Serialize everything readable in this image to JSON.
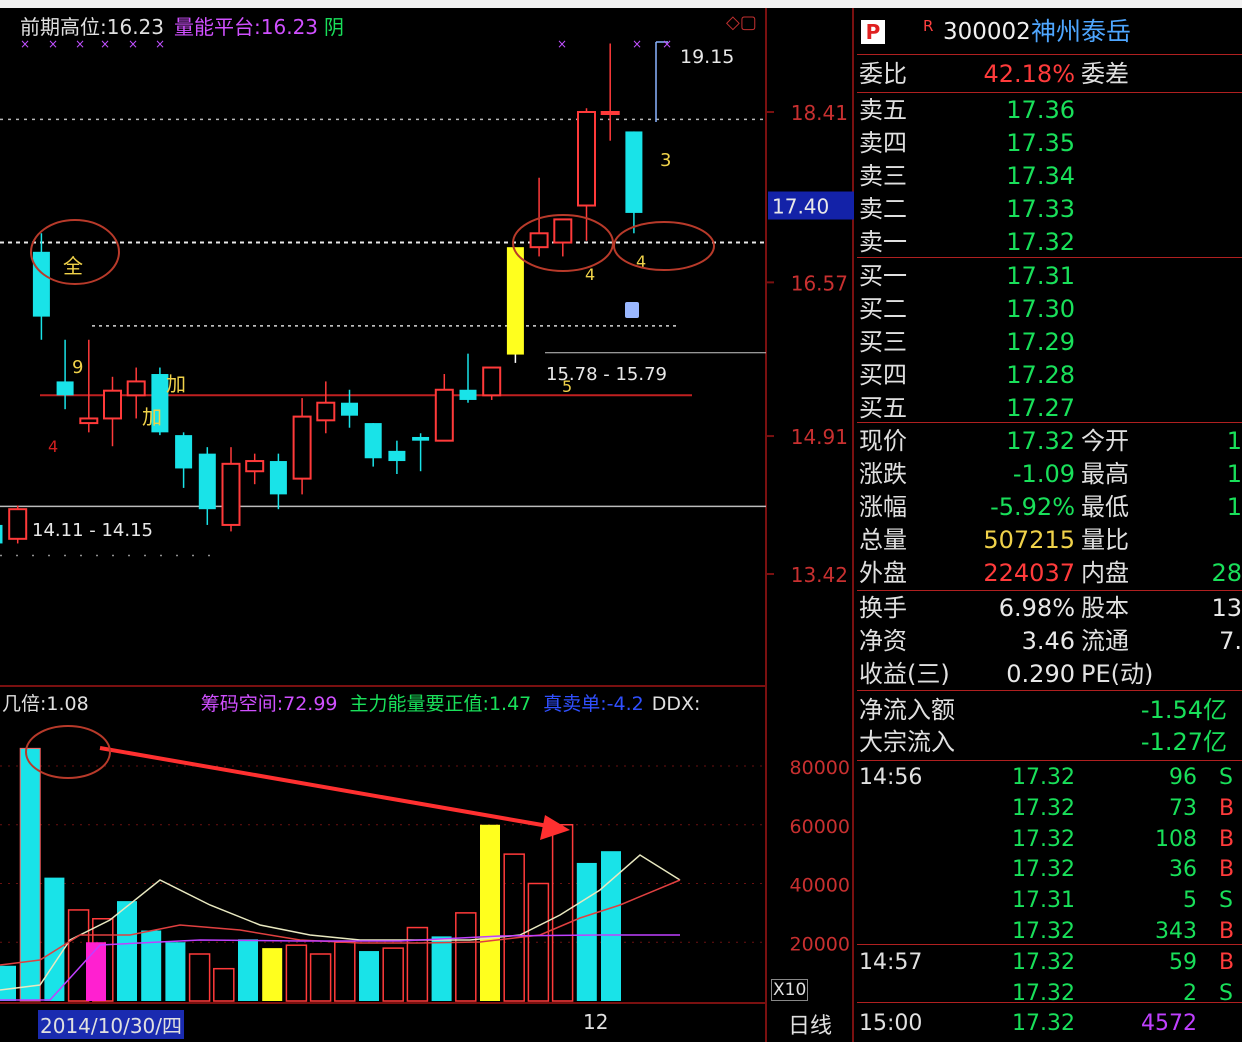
{
  "colors": {
    "up": "#ff3a3a",
    "down": "#19e3e8",
    "highlight": "#ffff1e",
    "bg": "#000000",
    "grid": "#7a1010"
  },
  "indicator_bar": {
    "prev_high_label": "前期高位:",
    "prev_high_value": "16.23",
    "energy_label": "量能平台:",
    "energy_value": "16.23",
    "suffix": "阴"
  },
  "volume_indicator_bar": {
    "ratio_label": "几倍:",
    "ratio_value": "1.08",
    "chip_label": "筹码空间:",
    "chip_value": "72.99",
    "main_label": "主力能量要正值:",
    "main_value": "1.47",
    "flow_label": "真卖单:",
    "flow_value": "-4.2",
    "ddx_label": "DDX:"
  },
  "chart_data": [
    {
      "type": "candlestick",
      "price_axis_ticks": [
        "18.41",
        "16.57",
        "14.91",
        "13.42"
      ],
      "current_price_tag": "17.40",
      "annotations": [
        "19.15",
        "15.78 - 15.79",
        "14.11 - 14.15",
        "9",
        "加",
        "加",
        "全",
        "3",
        "4",
        "4",
        "5",
        "4"
      ],
      "candles": [
        {
          "o": 13.95,
          "h": 14.0,
          "l": 13.7,
          "c": 13.75
        },
        {
          "o": 13.8,
          "h": 14.16,
          "l": 13.75,
          "c": 14.12
        },
        {
          "o": 16.9,
          "h": 17.1,
          "l": 15.95,
          "c": 16.2
        },
        {
          "o": 15.5,
          "h": 15.95,
          "l": 15.2,
          "c": 15.35
        },
        {
          "o": 15.05,
          "h": 15.95,
          "l": 14.95,
          "c": 15.1
        },
        {
          "o": 15.1,
          "h": 15.55,
          "l": 14.8,
          "c": 15.4
        },
        {
          "o": 15.35,
          "h": 15.65,
          "l": 15.1,
          "c": 15.5
        },
        {
          "o": 15.58,
          "h": 15.65,
          "l": 14.92,
          "c": 14.95
        },
        {
          "o": 14.92,
          "h": 14.95,
          "l": 14.35,
          "c": 14.56
        },
        {
          "o": 14.72,
          "h": 14.79,
          "l": 13.95,
          "c": 14.12
        },
        {
          "o": 13.95,
          "h": 14.79,
          "l": 13.88,
          "c": 14.61
        },
        {
          "o": 14.53,
          "h": 14.72,
          "l": 14.39,
          "c": 14.64
        },
        {
          "o": 14.64,
          "h": 14.72,
          "l": 14.12,
          "c": 14.28
        },
        {
          "o": 14.45,
          "h": 15.32,
          "l": 14.28,
          "c": 15.12
        },
        {
          "o": 15.08,
          "h": 15.5,
          "l": 14.94,
          "c": 15.27
        },
        {
          "o": 15.27,
          "h": 15.41,
          "l": 15.0,
          "c": 15.13
        },
        {
          "o": 15.05,
          "h": 15.05,
          "l": 14.58,
          "c": 14.67
        },
        {
          "o": 14.75,
          "h": 14.86,
          "l": 14.5,
          "c": 14.64
        },
        {
          "o": 14.9,
          "h": 14.94,
          "l": 14.53,
          "c": 14.86
        },
        {
          "o": 14.86,
          "h": 15.58,
          "l": 14.86,
          "c": 15.41
        },
        {
          "o": 15.41,
          "h": 15.8,
          "l": 15.27,
          "c": 15.3
        },
        {
          "o": 15.35,
          "h": 15.65,
          "l": 15.3,
          "c": 15.65
        },
        {
          "o": 15.79,
          "h": 16.8,
          "l": 15.7,
          "c": 16.95
        },
        {
          "o": 16.95,
          "h": 17.7,
          "l": 16.85,
          "c": 17.1
        },
        {
          "o": 17.0,
          "h": 17.25,
          "l": 16.85,
          "c": 17.25
        },
        {
          "o": 17.4,
          "h": 18.45,
          "l": 17.02,
          "c": 18.41
        },
        {
          "o": 18.41,
          "h": 19.15,
          "l": 18.1,
          "c": 18.41
        },
        {
          "o": 18.2,
          "h": 18.2,
          "l": 17.1,
          "c": 17.32
        }
      ]
    },
    {
      "type": "bar",
      "y_axis_ticks": [
        "80000",
        "60000",
        "40000",
        "20000"
      ],
      "multiplier_label": "X10",
      "x_tick_labels": [
        "2014/10/30/四",
        "12"
      ],
      "period_label": "日线",
      "volumes": [
        12000,
        86000,
        42000,
        31000,
        28000,
        34000,
        24000,
        20000,
        16000,
        11000,
        21000,
        18000,
        19000,
        16000,
        20000,
        17000,
        18000,
        25000,
        22000,
        30000,
        60000,
        50000,
        40000,
        60000,
        47000,
        51000
      ]
    }
  ],
  "quote": {
    "badge": "P",
    "badge2": "R",
    "code": "300002",
    "name": "神州泰岳",
    "wb_label": "委比",
    "wb_value": "42.18%",
    "wc_label": "委差",
    "asks": [
      {
        "label": "卖五",
        "price": "17.36"
      },
      {
        "label": "卖四",
        "price": "17.35"
      },
      {
        "label": "卖三",
        "price": "17.34"
      },
      {
        "label": "卖二",
        "price": "17.33"
      },
      {
        "label": "卖一",
        "price": "17.32"
      }
    ],
    "bids": [
      {
        "label": "买一",
        "price": "17.31"
      },
      {
        "label": "买二",
        "price": "17.30"
      },
      {
        "label": "买三",
        "price": "17.29"
      },
      {
        "label": "买四",
        "price": "17.28"
      },
      {
        "label": "买五",
        "price": "17.27"
      }
    ],
    "stats": [
      {
        "l1": "现价",
        "v1": "17.32",
        "c1": "g",
        "l2": "今开",
        "v2": "1"
      },
      {
        "l1": "涨跌",
        "v1": "-1.09",
        "c1": "g",
        "l2": "最高",
        "v2": "1"
      },
      {
        "l1": "涨幅",
        "v1": "-5.92%",
        "c1": "g",
        "l2": "最低",
        "v2": "1"
      },
      {
        "l1": "总量",
        "v1": "507215",
        "c1": "y",
        "l2": "量比",
        "v2": ""
      },
      {
        "l1": "外盘",
        "v1": "224037",
        "c1": "r",
        "l2": "内盘",
        "v2": "28"
      }
    ],
    "fin": [
      {
        "l1": "换手",
        "v1": "6.98%",
        "l2": "股本",
        "v2": "13"
      },
      {
        "l1": "净资",
        "v1": "3.46",
        "l2": "流通",
        "v2": "7."
      },
      {
        "l1": "收益(三)",
        "v1": "0.290",
        "l2": "PE(动)",
        "v2": ""
      }
    ],
    "flow": [
      {
        "label": "净流入额",
        "value": "-1.54亿"
      },
      {
        "label": "大宗流入",
        "value": "-1.27亿"
      }
    ],
    "ticks": [
      {
        "time": "14:56",
        "price": "17.32",
        "vol": "96",
        "side": "S"
      },
      {
        "time": "",
        "price": "17.32",
        "vol": "73",
        "side": "B"
      },
      {
        "time": "",
        "price": "17.32",
        "vol": "108",
        "side": "B"
      },
      {
        "time": "",
        "price": "17.32",
        "vol": "36",
        "side": "B"
      },
      {
        "time": "",
        "price": "17.31",
        "vol": "5",
        "side": "S"
      },
      {
        "time": "",
        "price": "17.32",
        "vol": "343",
        "side": "B"
      },
      {
        "time": "14:57",
        "price": "17.32",
        "vol": "59",
        "side": "B"
      },
      {
        "time": "",
        "price": "17.32",
        "vol": "2",
        "side": "S"
      },
      {
        "time": "15:00",
        "price": "17.32",
        "vol": "4572",
        "side": ""
      }
    ]
  }
}
